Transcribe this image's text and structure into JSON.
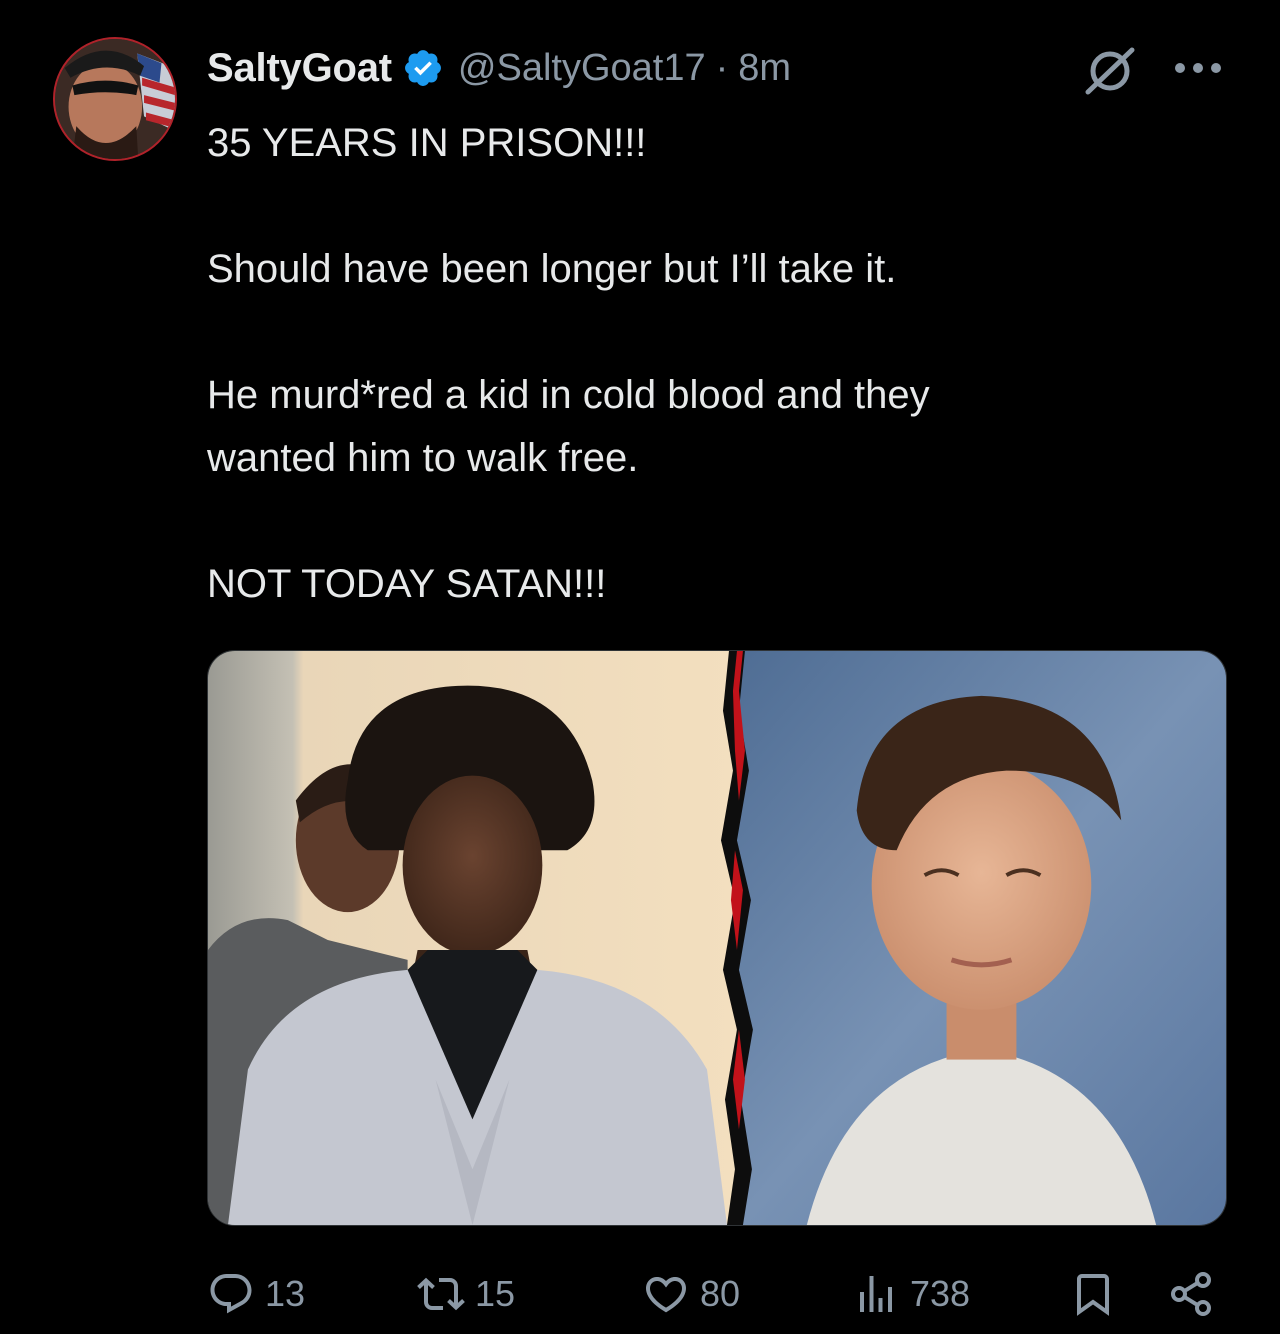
{
  "tweet": {
    "author": {
      "display_name": "SaltyGoat",
      "handle": "@SaltyGoat17",
      "separator": "·",
      "time": "8m",
      "verified": true,
      "badge_color": "#1d9bf0"
    },
    "lines": [
      "35 YEARS IN PRISON!!!",
      "",
      "Should have been longer but I’ll take it.",
      "",
      "He murd*red a kid in cold blood and they",
      "wanted him to walk free.",
      "",
      "NOT TODAY SATAN!!!"
    ],
    "media": {
      "left_panel": "man in light gray suit and black shirt, officer behind",
      "right_panel": "young man school portrait, blue backdrop",
      "divider": "torn red edge"
    }
  },
  "actions": {
    "reply": {
      "icon": "reply-icon",
      "count": "13"
    },
    "retweet": {
      "icon": "retweet-icon",
      "count": "15"
    },
    "like": {
      "icon": "heart-icon",
      "count": "80"
    },
    "views": {
      "icon": "views-icon",
      "count": "738"
    },
    "bookmark": {
      "icon": "bookmark-icon"
    },
    "share": {
      "icon": "share-icon"
    }
  },
  "colors": {
    "background": "#000000",
    "text": "#e7e9ea",
    "muted": "#8b98a5",
    "verified": "#1d9bf0"
  }
}
